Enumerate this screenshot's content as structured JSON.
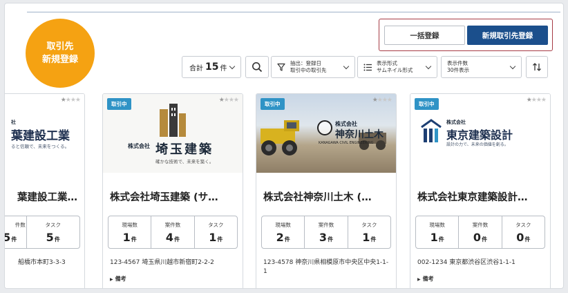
{
  "header": {
    "badge_line1": "取引先",
    "badge_line2": "新規登録",
    "bulk_button": "一括登録",
    "new_button": "新規取引先登録"
  },
  "toolbar": {
    "total_prefix": "合計",
    "total_count": "15",
    "total_unit": "件",
    "filter_line1": "抽出：登録日",
    "filter_line2": "取引中の取引先",
    "view_line1": "表示形式",
    "view_line2": "サムネイル形式",
    "per_line1": "表示件数",
    "per_line2": "30件表示"
  },
  "cards": [
    {
      "tag": "",
      "logo_kicker": "社",
      "logo_main": "葉建設工業",
      "logo_sub": "ると信頼で、未来をつくる。",
      "name": "葉建設工業…",
      "stats": [
        {
          "label": "件数",
          "value": "5",
          "unit": "件"
        },
        {
          "label": "タスク",
          "value": "5",
          "unit": "件"
        }
      ],
      "address": "船橋市本町3-3-3"
    },
    {
      "tag": "取引中",
      "logo_kicker": "株式会社",
      "logo_main": "埼玉建築",
      "logo_sub": "確かな技術で、未来を築く。",
      "name": "株式会社埼玉建築 (サ…",
      "stats": [
        {
          "label": "現場数",
          "value": "1",
          "unit": "件"
        },
        {
          "label": "案件数",
          "value": "4",
          "unit": "件"
        },
        {
          "label": "タスク",
          "value": "1",
          "unit": "件"
        }
      ],
      "address": "123-4567 埼玉県川越市新宿町2-2-2",
      "memo": "備考"
    },
    {
      "tag": "取引中",
      "logo_kicker": "株式会社",
      "logo_main": "神奈川土木",
      "logo_sub": "KANAGAWA CIVIL ENGINEERING",
      "name": "株式会社神奈川土木 (…",
      "stats": [
        {
          "label": "現場数",
          "value": "2",
          "unit": "件"
        },
        {
          "label": "案件数",
          "value": "3",
          "unit": "件"
        },
        {
          "label": "タスク",
          "value": "1",
          "unit": "件"
        }
      ],
      "address": "123-4578 神奈川県相模原市中央区中央1-1-1"
    },
    {
      "tag": "取引中",
      "logo_kicker": "株式会社",
      "logo_main": "東京建築設計",
      "logo_sub": "設計の力で、未来の価値を創る。",
      "name": "株式会社東京建築設計…",
      "stats": [
        {
          "label": "現場数",
          "value": "1",
          "unit": "件"
        },
        {
          "label": "案件数",
          "value": "0",
          "unit": "件"
        },
        {
          "label": "タスク",
          "value": "0",
          "unit": "件"
        }
      ],
      "address": "002-1234 東京都渋谷区渋谷1-1-1",
      "memo": "備考"
    }
  ],
  "colors": {
    "accent_orange": "#f5a212",
    "primary_blue": "#1b4f8c",
    "tag_blue": "#2f93c6",
    "highlight_red": "#a63a44"
  }
}
